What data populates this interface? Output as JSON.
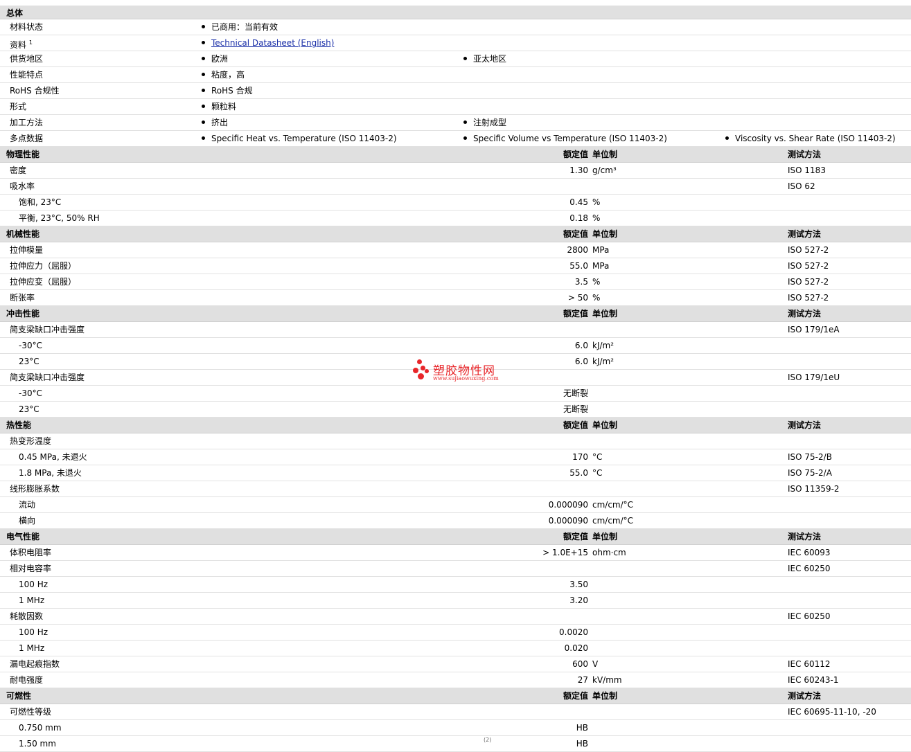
{
  "sections": [
    {
      "id": "general",
      "title": "总体",
      "show_headers": false,
      "rows": [
        {
          "label": "材料状态",
          "bullets": [
            "已商用：当前有效"
          ]
        },
        {
          "label": "资料",
          "sup": "1",
          "bullets": [],
          "link": "Technical Datasheet (English)"
        },
        {
          "label": "供货地区",
          "bullets": [
            "欧洲",
            "亚太地区"
          ]
        },
        {
          "label": "性能特点",
          "bullets": [
            "粘度，高"
          ]
        },
        {
          "label": "RoHS 合规性",
          "bullets": [
            "RoHS 合规"
          ]
        },
        {
          "label": "形式",
          "bullets": [
            "颗粒料"
          ]
        },
        {
          "label": "加工方法",
          "bullets": [
            "挤出",
            "注射成型"
          ]
        },
        {
          "label": "多点数据",
          "bullets": [
            "Specific Heat vs. Temperature (ISO 11403-2)",
            "Specific Volume vs Temperature (ISO 11403-2)",
            "Viscosity vs. Shear Rate (ISO 11403-2)"
          ]
        }
      ]
    },
    {
      "id": "physical",
      "title": "物理性能",
      "show_headers": true,
      "rows": [
        {
          "label": "密度",
          "value": "1.30",
          "unit": "g/cm³",
          "test": "ISO 1183"
        },
        {
          "label": "吸水率",
          "value": "",
          "unit": "",
          "test": "ISO 62"
        },
        {
          "label": "饱和, 23°C",
          "indent": true,
          "value": "0.45",
          "unit": "%",
          "test": ""
        },
        {
          "label": "平衡, 23°C, 50% RH",
          "indent": true,
          "value": "0.18",
          "unit": "%",
          "test": ""
        }
      ]
    },
    {
      "id": "mechanical",
      "title": "机械性能",
      "show_headers": true,
      "rows": [
        {
          "label": "拉伸模量",
          "value": "2800",
          "unit": "MPa",
          "test": "ISO 527-2"
        },
        {
          "label": "拉伸应力（屈服）",
          "value": "55.0",
          "unit": "MPa",
          "test": "ISO 527-2"
        },
        {
          "label": "拉伸应变（屈服）",
          "value": "3.5",
          "unit": "%",
          "test": "ISO 527-2"
        },
        {
          "label": "断张率",
          "value": "> 50",
          "unit": "%",
          "test": "ISO 527-2"
        }
      ]
    },
    {
      "id": "impact",
      "title": "冲击性能",
      "show_headers": true,
      "rows": [
        {
          "label": "简支梁缺口冲击强度",
          "value": "",
          "unit": "",
          "test": "ISO 179/1eA"
        },
        {
          "label": "-30°C",
          "indent": true,
          "value": "6.0",
          "unit": "kJ/m²",
          "test": ""
        },
        {
          "label": "23°C",
          "indent": true,
          "value": "6.0",
          "unit": "kJ/m²",
          "test": ""
        },
        {
          "label": "简支梁缺口冲击强度",
          "value": "",
          "unit": "",
          "test": "ISO 179/1eU"
        },
        {
          "label": "-30°C",
          "indent": true,
          "value": "无断裂",
          "unit": "",
          "test": ""
        },
        {
          "label": "23°C",
          "indent": true,
          "value": "无断裂",
          "unit": "",
          "test": ""
        }
      ]
    },
    {
      "id": "thermal",
      "title": "热性能",
      "show_headers": true,
      "rows": [
        {
          "label": "热变形温度",
          "value": "",
          "unit": "",
          "test": ""
        },
        {
          "label": "0.45 MPa, 未退火",
          "indent": true,
          "value": "170",
          "unit": "°C",
          "test": "ISO 75-2/B"
        },
        {
          "label": "1.8 MPa, 未退火",
          "indent": true,
          "value": "55.0",
          "unit": "°C",
          "test": "ISO 75-2/A"
        },
        {
          "label": "线形膨胀系数",
          "value": "",
          "unit": "",
          "test": "ISO 11359-2"
        },
        {
          "label": "流动",
          "indent": true,
          "value": "0.000090",
          "unit": "cm/cm/°C",
          "test": ""
        },
        {
          "label": "横向",
          "indent": true,
          "value": "0.000090",
          "unit": "cm/cm/°C",
          "test": ""
        }
      ]
    },
    {
      "id": "electrical",
      "title": "电气性能",
      "show_headers": true,
      "rows": [
        {
          "label": "体积电阻率",
          "value": "> 1.0E+15",
          "unit": "ohm·cm",
          "test": "IEC 60093"
        },
        {
          "label": "相对电容率",
          "value": "",
          "unit": "",
          "test": "IEC 60250"
        },
        {
          "label": "100 Hz",
          "indent": true,
          "value": "3.50",
          "unit": "",
          "test": ""
        },
        {
          "label": "1 MHz",
          "indent": true,
          "value": "3.20",
          "unit": "",
          "test": ""
        },
        {
          "label": "耗散因数",
          "value": "",
          "unit": "",
          "test": "IEC 60250"
        },
        {
          "label": "100 Hz",
          "indent": true,
          "value": "0.0020",
          "unit": "",
          "test": ""
        },
        {
          "label": "1 MHz",
          "indent": true,
          "value": "0.020",
          "unit": "",
          "test": ""
        },
        {
          "label": "漏电起痕指数",
          "value": "600",
          "unit": "V",
          "test": "IEC 60112"
        },
        {
          "label": "耐电强度",
          "value": "27",
          "unit": "kV/mm",
          "test": "IEC 60243-1"
        }
      ]
    },
    {
      "id": "flammability",
      "title": "可燃性",
      "show_headers": true,
      "rows": [
        {
          "label": "可燃性等级",
          "value": "",
          "unit": "",
          "test": "IEC 60695-11-10, -20"
        },
        {
          "label": "0.750 mm",
          "indent": true,
          "value": "HB",
          "unit": "",
          "test": ""
        },
        {
          "label": "1.50 mm",
          "indent": true,
          "value": "HB",
          "unit": "",
          "test": ""
        }
      ]
    }
  ],
  "headers": {
    "value": "额定值",
    "unit": "单位制",
    "test": "测试方法"
  },
  "watermark": {
    "name": "塑胶物性网",
    "url": "www.sujiaowuxing.com"
  },
  "bottom_mark": "(2)"
}
